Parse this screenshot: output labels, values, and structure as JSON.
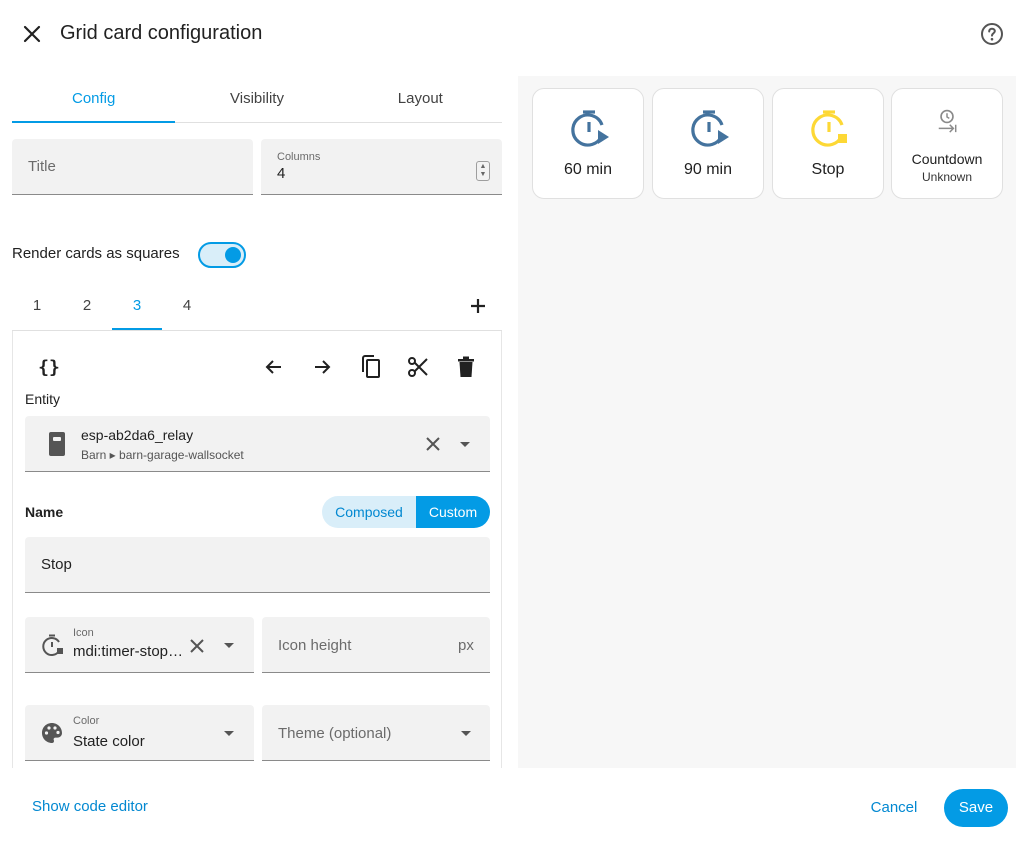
{
  "dialog": {
    "title": "Grid card configuration"
  },
  "tabs": [
    {
      "label": "Config"
    },
    {
      "label": "Visibility"
    },
    {
      "label": "Layout"
    }
  ],
  "fields": {
    "title_placeholder": "Title",
    "columns_label": "Columns",
    "columns_value": "4"
  },
  "toggle": {
    "label": "Render cards as squares",
    "checked": true
  },
  "card_tabs": [
    {
      "label": "1"
    },
    {
      "label": "2"
    },
    {
      "label": "3"
    },
    {
      "label": "4"
    }
  ],
  "card_tabs_active": "3",
  "editor": {
    "entity_label": "Entity",
    "entity_name": "esp-ab2da6_relay",
    "entity_path": "Barn ▸ barn-garage-wallsocket",
    "name_label": "Name",
    "name_modes": {
      "composed": "Composed",
      "custom": "Custom"
    },
    "name_value": "Stop",
    "icon_label": "Icon",
    "icon_value": "mdi:timer-stop…",
    "icon_height_placeholder": "Icon height",
    "icon_height_suffix": "px",
    "color_label": "Color",
    "color_value": "State color",
    "theme_placeholder": "Theme (optional)"
  },
  "preview_cards": [
    {
      "label": "60 min",
      "icon": "timer-play-icon",
      "color": "#44739e"
    },
    {
      "label": "90 min",
      "icon": "timer-play-icon",
      "color": "#44739e"
    },
    {
      "label": "Stop",
      "icon": "timer-stop-icon",
      "color": "#fdd835"
    },
    {
      "label": "Countdown",
      "sublabel": "Unknown",
      "icon": "timer-arrow-icon",
      "color": "#8a8a8a"
    }
  ],
  "footer": {
    "code_editor": "Show code editor",
    "cancel": "Cancel",
    "save": "Save"
  },
  "colors": {
    "accent": "#039be5",
    "accent_light": "#d9eef9",
    "timer_blue": "#44739e",
    "timer_yellow": "#fdd835"
  }
}
